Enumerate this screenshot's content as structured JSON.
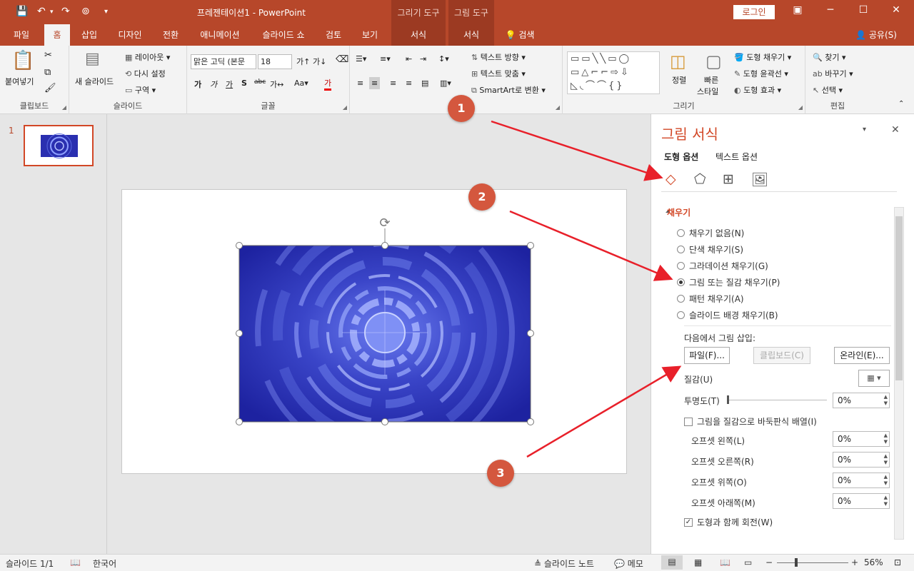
{
  "titlebar": {
    "doc_title": "프레젠테이션1  -  PowerPoint",
    "ctx_drawing_tools": "그리기 도구",
    "ctx_picture_tools": "그림 도구",
    "login": "로그인"
  },
  "tabs": {
    "file": "파일",
    "home": "홈",
    "insert": "삽입",
    "design": "디자인",
    "transitions": "전환",
    "animations": "애니메이션",
    "slideshow": "슬라이드 쇼",
    "review": "검토",
    "view": "보기",
    "format1": "서식",
    "format2": "서식",
    "search": "검색",
    "share": "공유(S)"
  },
  "ribbon": {
    "clipboard": {
      "paste": "붙여넣기",
      "label": "클립보드"
    },
    "slides": {
      "new_slide": "새 슬라이드",
      "layout": "레이아웃",
      "reset": "다시 설정",
      "section": "구역",
      "label": "슬라이드"
    },
    "font": {
      "name": "맑은 고딕 (본문",
      "size": "18",
      "label": "글꼴"
    },
    "paragraph": {
      "text_direction": "텍스트 방향",
      "align_text": "텍스트 맞춤",
      "smartart": "SmartArt로 변환",
      "label": "단락"
    },
    "drawing": {
      "arrange": "정렬",
      "quick_styles_line1": "빠른",
      "quick_styles_line2": "스타일",
      "shape_fill": "도형 채우기",
      "shape_outline": "도형 윤곽선",
      "shape_effects": "도형 효과",
      "label": "그리기"
    },
    "editing": {
      "find": "찾기",
      "replace": "바꾸기",
      "select": "선택",
      "label": "편집"
    }
  },
  "thumbnails": {
    "slide_number": "1"
  },
  "format_pane": {
    "title": "그림 서식",
    "tab_shape_options": "도형 옵션",
    "tab_text_options": "텍스트 옵션",
    "section_fill": "채우기",
    "fill_options": [
      {
        "label": "채우기 없음(N)",
        "checked": false
      },
      {
        "label": "단색 채우기(S)",
        "checked": false
      },
      {
        "label": "그라데이션 채우기(G)",
        "checked": false
      },
      {
        "label": "그림 또는 질감 채우기(P)",
        "checked": true
      },
      {
        "label": "패턴 채우기(A)",
        "checked": false
      },
      {
        "label": "슬라이드 배경 채우기(B)",
        "checked": false
      }
    ],
    "insert_from": "다음에서 그림 삽입:",
    "btn_file": "파일(F)...",
    "btn_clipboard": "클립보드(C)",
    "btn_online": "온라인(E)...",
    "texture_label": "질감(U)",
    "transparency_label": "투명도(T)",
    "transparency_value": "0%",
    "tile_label": "그림을 질감으로 바둑판식 배열(I)",
    "tile_checked": false,
    "offset_left_label": "오프셋 왼쪽(L)",
    "offset_left_value": "0%",
    "offset_right_label": "오프셋 오른쪽(R)",
    "offset_right_value": "0%",
    "offset_top_label": "오프셋 위쪽(O)",
    "offset_top_value": "0%",
    "offset_bottom_label": "오프셋 아래쪽(M)",
    "offset_bottom_value": "0%",
    "rotate_label": "도형과 함께 회전(W)",
    "rotate_checked": true
  },
  "statusbar": {
    "slide_info": "슬라이드 1/1",
    "language": "한국어",
    "notes": "슬라이드 노트",
    "comments": "메모",
    "zoom": "56%"
  },
  "callouts": {
    "c1": "1",
    "c2": "2",
    "c3": "3"
  },
  "colors": {
    "accent": "#b7472a",
    "pane_title": "#d24726",
    "callout": "#d4573e",
    "arrow": "#e8202a",
    "picture_blue": "#2a2fb0"
  }
}
